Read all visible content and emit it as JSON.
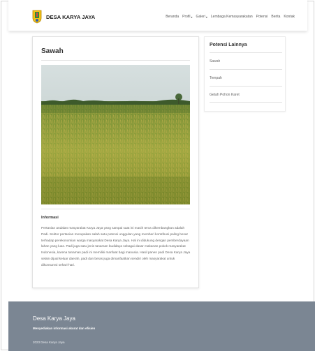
{
  "header": {
    "brand": "DESA KARYA JAYA",
    "nav": [
      {
        "label": "Beranda"
      },
      {
        "label": "Profil",
        "dropdown": true
      },
      {
        "label": "Galeri",
        "dropdown": true
      },
      {
        "label": "Lembaga Kemasyarakatan"
      },
      {
        "label": "Potensi"
      },
      {
        "label": "Berita"
      },
      {
        "label": "Kontak"
      }
    ]
  },
  "main": {
    "title": "Sawah",
    "info_title": "Informasi",
    "info_text": "Pertanian andalan masyarakat Karya Jaya yang sampai saat ini masih terus dikembangkan adalah Padi. Sektor pertanian merupakan salah satu potensi unggulan yang memberi kontribusi paling besar terhadap perekonomian warga masyarakat Desa Karya Jaya. Hal ini didukung dengan pemberdayaan lahan yang luas. Padi juga satu jenis tanaman budidaya sebagai dasar makanan pokok masyarakat Indonesia, karena tanaman padi ini memiliki manfaat bagi manusia. Hasil panen padi Desa Karya Jaya selain dijual keluar daerah, padi dan beras juga dimanfaatkan sendiri oleh masyarakat untuk dikonsumsi sehari-hari."
  },
  "sidebar": {
    "title": "Potensi Lainnya",
    "items": [
      {
        "label": "Sawah"
      },
      {
        "label": "Tempah"
      },
      {
        "label": "Getah Pohon Karet"
      }
    ]
  },
  "footer": {
    "title": "Desa Karya Jaya",
    "subtitle": "Menyediakan informasi akurat dan efisien",
    "copyright": "2023 Desa Karya Jaya"
  },
  "colors": {
    "footer_bg": "#7b8693",
    "logo_yellow": "#f2c218",
    "logo_green": "#2f8a3a"
  },
  "icons": {
    "logo": "village-crest-logo",
    "dropdown": "caret-down-icon"
  }
}
